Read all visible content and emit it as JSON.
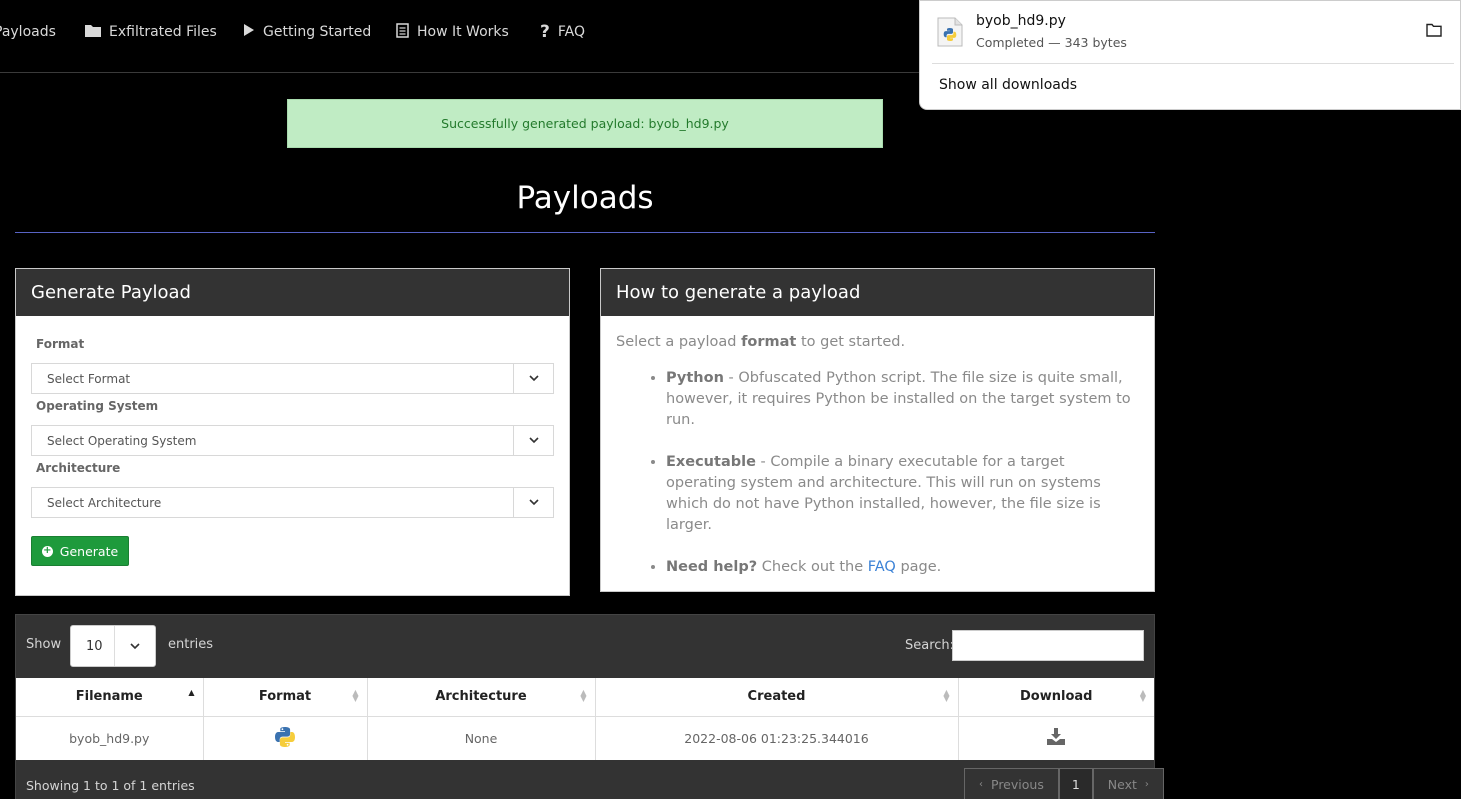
{
  "nav": {
    "items": [
      {
        "label": "Payloads",
        "icon": "none"
      },
      {
        "label": "Exfiltrated Files",
        "icon": "folder-icon"
      },
      {
        "label": "Getting Started",
        "icon": "play-icon"
      },
      {
        "label": "How It Works",
        "icon": "document-icon"
      },
      {
        "label": "FAQ",
        "icon": "question-icon"
      }
    ]
  },
  "alert": {
    "text": "Successfully generated payload: byob_hd9.py"
  },
  "page": {
    "title": "Payloads"
  },
  "generate": {
    "title": "Generate Payload",
    "format_label": "Format",
    "format_value": "Select Format",
    "os_label": "Operating System",
    "os_value": "Select Operating System",
    "arch_label": "Architecture",
    "arch_value": "Select Architecture",
    "button": "Generate"
  },
  "how": {
    "title": "How to generate a payload",
    "intro_pre": "Select a payload ",
    "intro_bold": "format",
    "intro_post": " to get started.",
    "python_bold": "Python",
    "python_text": " - Obfuscated Python script. The file size is quite small, however, it requires Python be installed on the target system to run.",
    "exe_bold": "Executable",
    "exe_text": " - Compile a binary executable for a target operating system and architecture. This will run on systems which do not have Python installed, however, the file size is larger.",
    "help_bold": "Need help?",
    "help_pre": " Check out the ",
    "help_link": "FAQ",
    "help_post": " page."
  },
  "table": {
    "show_label": "Show",
    "length_value": "10",
    "entries_label": "entries",
    "search_label": "Search:",
    "columns": [
      "Filename",
      "Format",
      "Architecture",
      "Created",
      "Download"
    ],
    "rows": [
      {
        "filename": "byob_hd9.py",
        "format_icon": "python-icon",
        "architecture": "None",
        "created": "2022-08-06 01:23:25.344016"
      }
    ],
    "info": "Showing 1 to 1 of 1 entries",
    "prev": "Previous",
    "page": "1",
    "next": "Next"
  },
  "download": {
    "filename": "byob_hd9.py",
    "status": "Completed — 343 bytes",
    "show_all": "Show all downloads"
  }
}
